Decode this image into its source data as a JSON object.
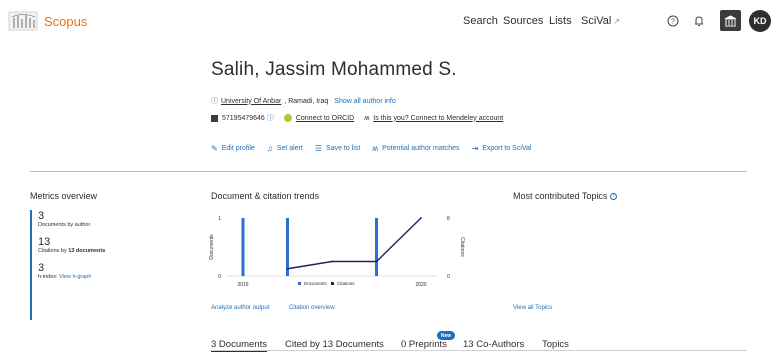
{
  "header": {
    "logo_text": "Scopus",
    "nav": [
      "Search",
      "Sources",
      "Lists",
      "SciVal"
    ],
    "avatar_initials": "KD"
  },
  "author": {
    "name": "Salih, Jassim Mohammed S.",
    "affiliation": "University Of Anbar",
    "location": ", Ramadi, Iraq",
    "show_all": "Show all author info",
    "author_id": "57195479646",
    "orcid": "Connect to ORCID",
    "mendeley": "Is this you? Connect to Mendeley account"
  },
  "actions": [
    "Edit profile",
    "Set alert",
    "Save to list",
    "Potential author matches",
    "Export to SciVal"
  ],
  "metrics": {
    "title": "Metrics overview",
    "documents": "3",
    "documents_label": "Documents by author",
    "citations": "13",
    "citations_label_pre": "Citations by ",
    "citations_label_bold": "13 documents",
    "hindex": "3",
    "hindex_label": "h-index:",
    "hindex_link": "View h-graph"
  },
  "chart": {
    "title": "Document & citation trends",
    "analyze_link": "Analyze author output",
    "citation_link": "Citation overview"
  },
  "chart_data": {
    "type": "bar",
    "x": [
      2016,
      2017,
      2018,
      2019,
      2020
    ],
    "x_tick_labels": [
      "2016",
      "2020"
    ],
    "series": [
      {
        "name": "Documents",
        "type": "bar",
        "axis": "left",
        "values": [
          1,
          1,
          0,
          1,
          0
        ]
      },
      {
        "name": "Citations",
        "type": "line",
        "axis": "right",
        "values": [
          null,
          1,
          2,
          2,
          8
        ]
      }
    ],
    "ylabel": "Documents",
    "y2label": "Citations",
    "ylim": [
      0,
      1
    ],
    "y2lim": [
      0,
      8
    ],
    "y_ticks": [
      "0",
      "1"
    ],
    "y2_ticks": [
      "0",
      "8"
    ],
    "legend_position": "bottom",
    "colors": {
      "documents": "#2f6ed1",
      "citations": "#1a2560"
    }
  },
  "topics": {
    "title": "Most contributed Topics",
    "link": "View all Topics"
  },
  "tabs": [
    "3 Documents",
    "Cited by 13 Documents",
    "0 Preprints",
    "13 Co-Authors",
    "Topics"
  ],
  "new_badge": "New"
}
